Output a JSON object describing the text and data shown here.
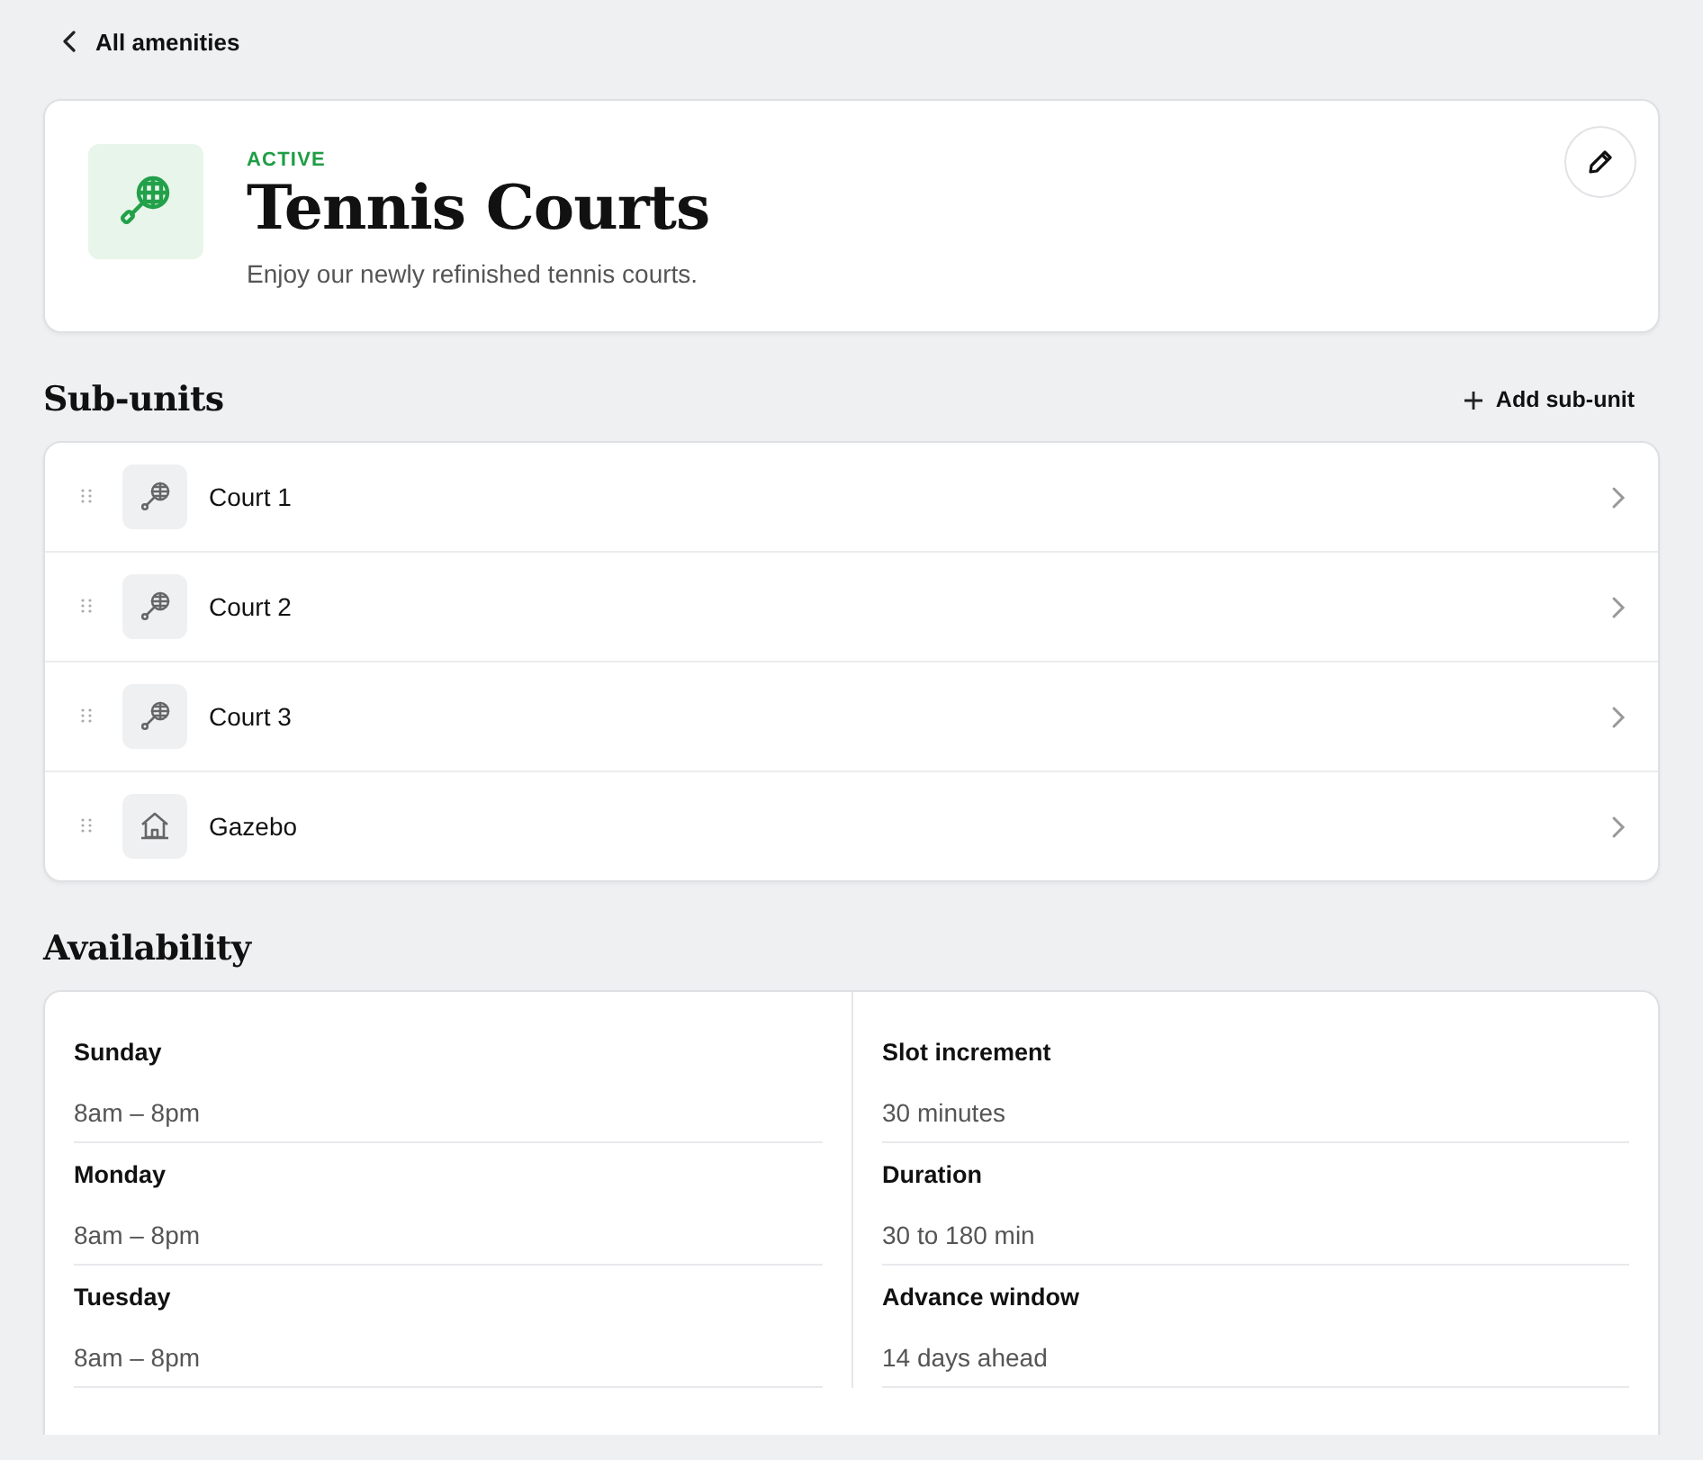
{
  "back_link": {
    "label": "All amenities"
  },
  "amenity": {
    "status": "ACTIVE",
    "title": "Tennis Courts",
    "description": "Enjoy our newly refinished tennis courts."
  },
  "sub_units": {
    "heading": "Sub-units",
    "add_button": "Add sub-unit",
    "items": [
      {
        "name": "Court 1",
        "kind": "court"
      },
      {
        "name": "Court 2",
        "kind": "court"
      },
      {
        "name": "Court 3",
        "kind": "court"
      },
      {
        "name": "Gazebo",
        "kind": "building"
      }
    ]
  },
  "availability": {
    "heading": "Availability",
    "hours": [
      {
        "day": "Sunday",
        "time": "8am – 8pm"
      },
      {
        "day": "Monday",
        "time": "8am – 8pm"
      },
      {
        "day": "Tuesday",
        "time": "8am – 8pm"
      }
    ],
    "rules": [
      {
        "label": "Slot increment",
        "value": "30 minutes"
      },
      {
        "label": "Duration",
        "value": "30 to 180 min"
      },
      {
        "label": "Advance window",
        "value": "14 days ahead"
      }
    ]
  }
}
